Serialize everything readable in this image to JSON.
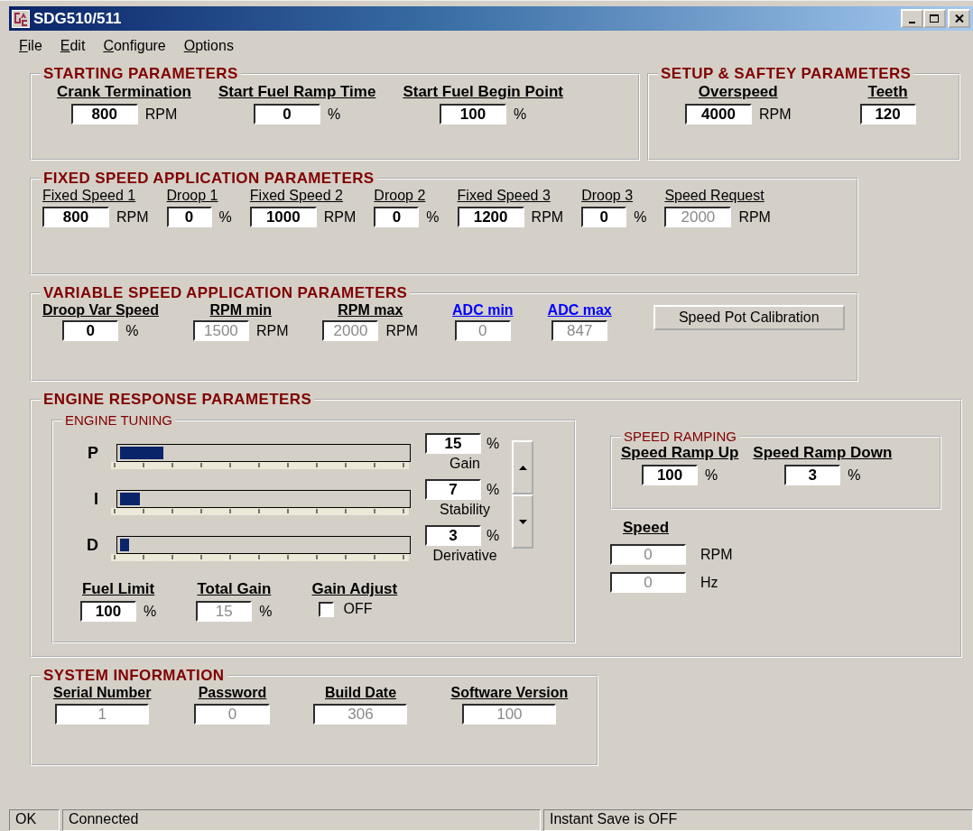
{
  "window": {
    "title": "SDG510/511"
  },
  "menu": [
    {
      "label": "File"
    },
    {
      "label": "Edit"
    },
    {
      "label": "Configure"
    },
    {
      "label": "Options"
    }
  ],
  "starting": {
    "title": "STARTING PARAMETERS",
    "fields": [
      {
        "label": "Crank Termination",
        "value": "800",
        "unit": "RPM",
        "disabled": false
      },
      {
        "label": "Start Fuel Ramp Time",
        "value": "0",
        "unit": "%",
        "disabled": false
      },
      {
        "label": "Start Fuel Begin Point",
        "value": "100",
        "unit": "%",
        "disabled": false
      }
    ]
  },
  "setup": {
    "title": "SETUP & SAFTEY PARAMETERS",
    "fields": [
      {
        "label": "Overspeed",
        "value": "4000",
        "unit": "RPM",
        "disabled": false
      },
      {
        "label": "Teeth",
        "value": "120",
        "disabled": false
      }
    ]
  },
  "fixed_speed": {
    "title": "FIXED SPEED APPLICATION PARAMETERS",
    "fields": [
      {
        "label": "Fixed Speed 1",
        "value": "800",
        "unit": "RPM",
        "disabled": false
      },
      {
        "label": "Droop 1",
        "value": "0",
        "unit": "%",
        "disabled": false
      },
      {
        "label": "Fixed Speed 2",
        "value": "1000",
        "unit": "RPM",
        "disabled": false
      },
      {
        "label": "Droop 2",
        "value": "0",
        "unit": "%",
        "disabled": false
      },
      {
        "label": "Fixed Speed 3",
        "value": "1200",
        "unit": "RPM",
        "disabled": false
      },
      {
        "label": "Droop 3",
        "value": "0",
        "unit": "%",
        "disabled": false
      },
      {
        "label": "Speed Request",
        "value": "2000",
        "unit": "RPM",
        "disabled": true
      }
    ]
  },
  "variable_speed": {
    "title": "VARIABLE SPEED APPLICATION PARAMETERS",
    "fields": [
      {
        "label": "Droop Var Speed",
        "value": "0",
        "unit": "%",
        "disabled": false,
        "link": false
      },
      {
        "label": "RPM min",
        "value": "1500",
        "unit": "RPM",
        "disabled": true,
        "link": false
      },
      {
        "label": "RPM max",
        "value": "2000",
        "unit": "RPM",
        "disabled": true,
        "link": false
      },
      {
        "label": "ADC min",
        "value": "0",
        "disabled": true,
        "link": true
      },
      {
        "label": "ADC max",
        "value": "847",
        "disabled": true,
        "link": true
      }
    ],
    "button": "Speed Pot Calibration"
  },
  "engine_response": {
    "title": "ENGINE RESPONSE PARAMETERS",
    "tuning": {
      "title": "ENGINE TUNING",
      "sliders": [
        {
          "name": "P",
          "level": 0.15,
          "value": "15",
          "unit": "%",
          "caption": "Gain"
        },
        {
          "name": "I",
          "level": 0.07,
          "value": "7",
          "unit": "%",
          "caption": "Stability"
        },
        {
          "name": "D",
          "level": 0.03,
          "value": "3",
          "unit": "%",
          "caption": "Derivative"
        }
      ],
      "fields": [
        {
          "label": "Fuel Limit",
          "value": "100",
          "unit": "%",
          "disabled": false
        },
        {
          "label": "Total Gain",
          "value": "15",
          "unit": "%",
          "disabled": true
        }
      ],
      "gain_adjust": {
        "label": "Gain Adjust",
        "checked": false,
        "text": "OFF"
      }
    },
    "ramping": {
      "title": "SPEED RAMPING",
      "fields": [
        {
          "label": "Speed Ramp Up",
          "value": "100",
          "unit": "%",
          "disabled": false
        },
        {
          "label": "Speed Ramp Down",
          "value": "3",
          "unit": "%",
          "disabled": false
        }
      ]
    },
    "speed": {
      "label": "Speed",
      "readings": [
        {
          "value": "0",
          "unit": "RPM",
          "disabled": true
        },
        {
          "value": "0",
          "unit": "Hz",
          "disabled": true
        }
      ]
    }
  },
  "system": {
    "title": "SYSTEM INFORMATION",
    "fields": [
      {
        "label": "Serial Number",
        "value": "1",
        "disabled": true
      },
      {
        "label": "Password",
        "value": "0",
        "disabled": true
      },
      {
        "label": "Build Date",
        "value": "306",
        "disabled": true
      },
      {
        "label": "Software Version",
        "value": "100",
        "disabled": true
      }
    ]
  },
  "status_bar": [
    "OK",
    "Connected",
    "Instant Save is OFF"
  ]
}
